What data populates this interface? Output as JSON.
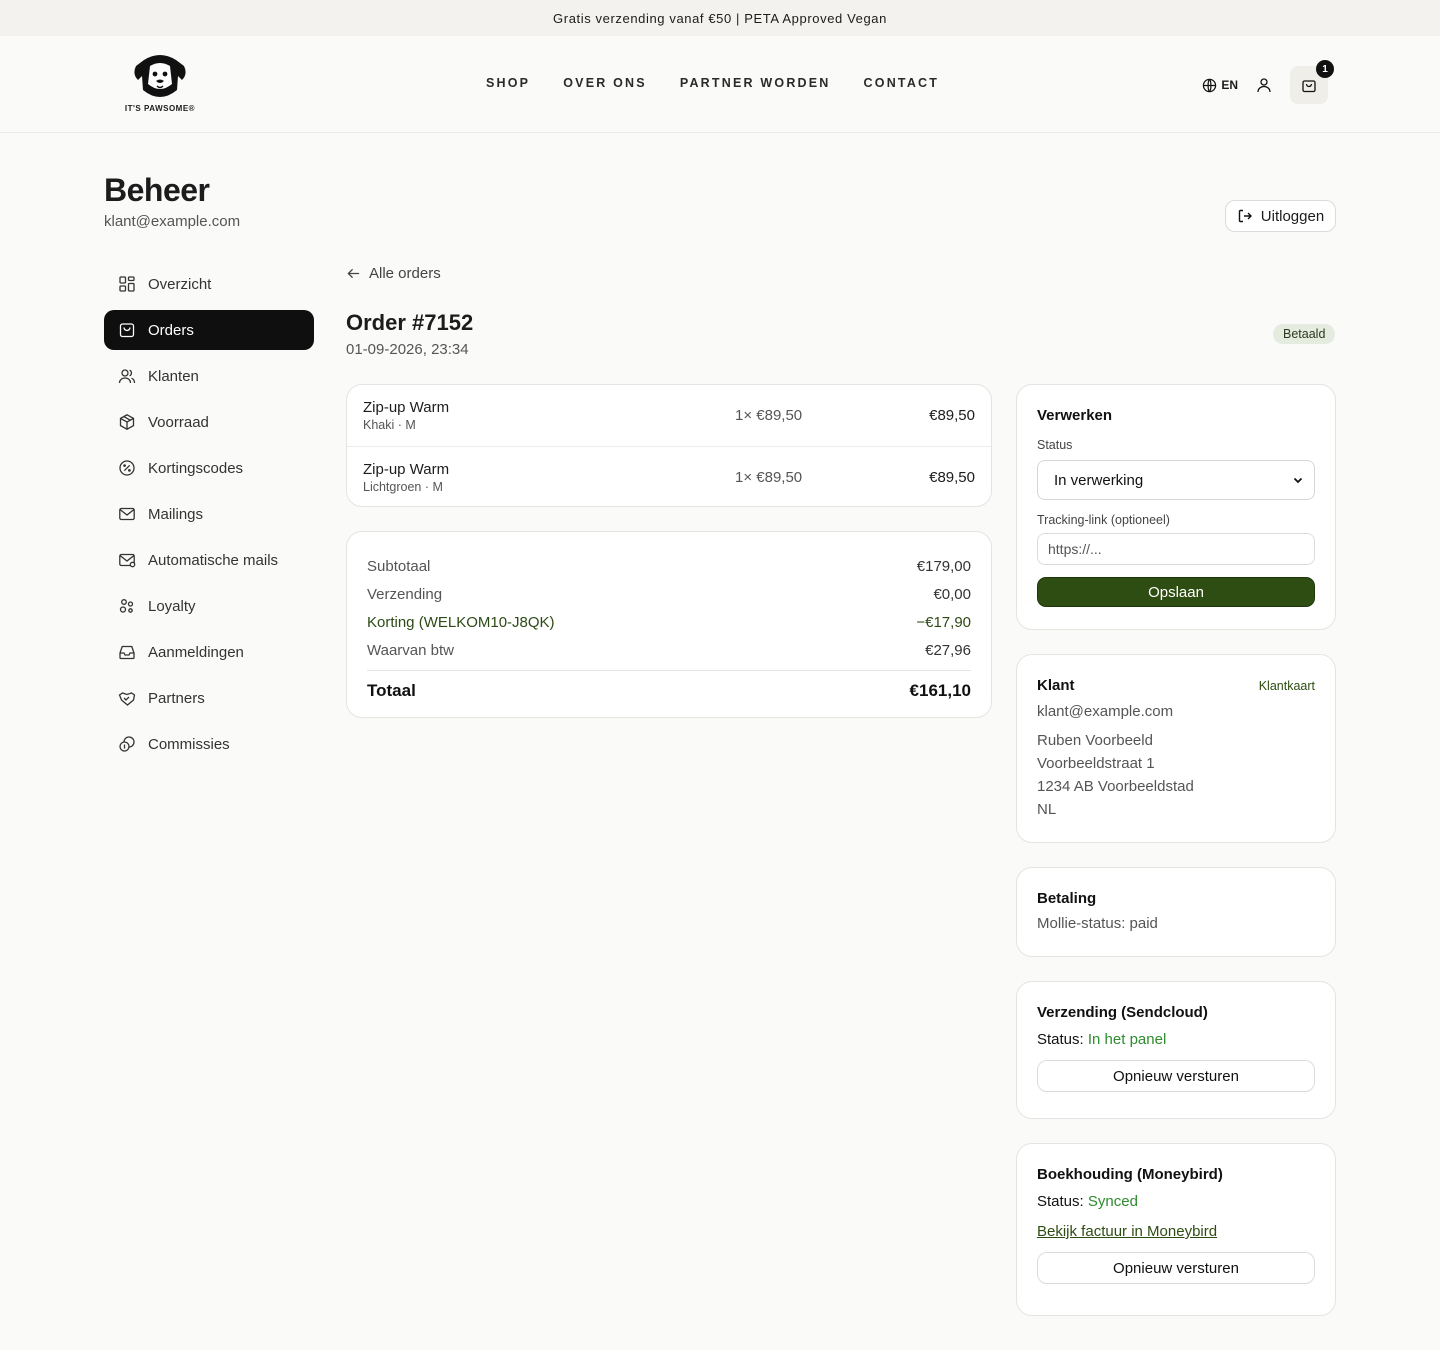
{
  "topbar": {
    "text": "Gratis verzending vanaf €50 | PETA Approved Vegan"
  },
  "header": {
    "logo_text": "IT'S PAWSOME®",
    "nav": [
      "SHOP",
      "OVER ONS",
      "PARTNER WORDEN",
      "CONTACT"
    ],
    "lang": "EN",
    "cart_count": "1"
  },
  "page": {
    "title": "Beheer",
    "email": "klant@example.com",
    "logout_label": "Uitloggen"
  },
  "sidebar": {
    "items": [
      {
        "label": "Overzicht",
        "icon": "grid-icon"
      },
      {
        "label": "Orders",
        "icon": "bag-icon"
      },
      {
        "label": "Klanten",
        "icon": "users-icon"
      },
      {
        "label": "Voorraad",
        "icon": "box-icon"
      },
      {
        "label": "Kortingscodes",
        "icon": "percent-badge-icon"
      },
      {
        "label": "Mailings",
        "icon": "mail-icon"
      },
      {
        "label": "Automatische mails",
        "icon": "mail-auto-icon"
      },
      {
        "label": "Loyalty",
        "icon": "loyalty-icon"
      },
      {
        "label": "Aanmeldingen",
        "icon": "inbox-icon"
      },
      {
        "label": "Partners",
        "icon": "handshake-icon"
      },
      {
        "label": "Commissies",
        "icon": "coins-icon"
      }
    ],
    "active_index": 1
  },
  "order": {
    "back_label": "Alle orders",
    "title": "Order #7152",
    "date": "01-09-2026, 23:34",
    "status_badge": "Betaald",
    "items": [
      {
        "name": "Zip-up Warm",
        "variant": "Khaki · M",
        "qty_price": "1× €89,50",
        "total": "€89,50"
      },
      {
        "name": "Zip-up Warm",
        "variant": "Lichtgroen · M",
        "qty_price": "1× €89,50",
        "total": "€89,50"
      }
    ],
    "totals": {
      "subtotal_label": "Subtotaal",
      "subtotal": "€179,00",
      "shipping_label": "Verzending",
      "shipping": "€0,00",
      "discount_label": "Korting (WELKOM10-J8QK)",
      "discount": "−€17,90",
      "vat_label": "Waarvan btw",
      "vat": "€27,96",
      "total_label": "Totaal",
      "total": "€161,10"
    }
  },
  "processing": {
    "title": "Verwerken",
    "status_label": "Status",
    "status_value": "In verwerking",
    "tracking_label": "Tracking-link (optioneel)",
    "tracking_placeholder": "https://...",
    "save_label": "Opslaan"
  },
  "customer": {
    "title": "Klant",
    "card_link": "Klantkaart",
    "email": "klant@example.com",
    "name": "Ruben Voorbeeld",
    "street": "Voorbeeldstraat 1",
    "city": "1234 AB Voorbeeldstad",
    "country": "NL"
  },
  "payment": {
    "title": "Betaling",
    "status": "Mollie-status: paid"
  },
  "shipping": {
    "title": "Verzending (Sendcloud)",
    "status_label": "Status:",
    "status_value": "In het panel",
    "resend_label": "Opnieuw versturen"
  },
  "accounting": {
    "title": "Boekhouding (Moneybird)",
    "status_label": "Status:",
    "status_value": "Synced",
    "invoice_link": "Bekijk factuur in Moneybird",
    "resend_label": "Opnieuw versturen"
  },
  "colors": {
    "accent": "#2e4d12",
    "status_green": "#2e8b2e",
    "active_nav_bg": "#0f0f0f",
    "paid_badge_bg": "#e6ebdf"
  }
}
